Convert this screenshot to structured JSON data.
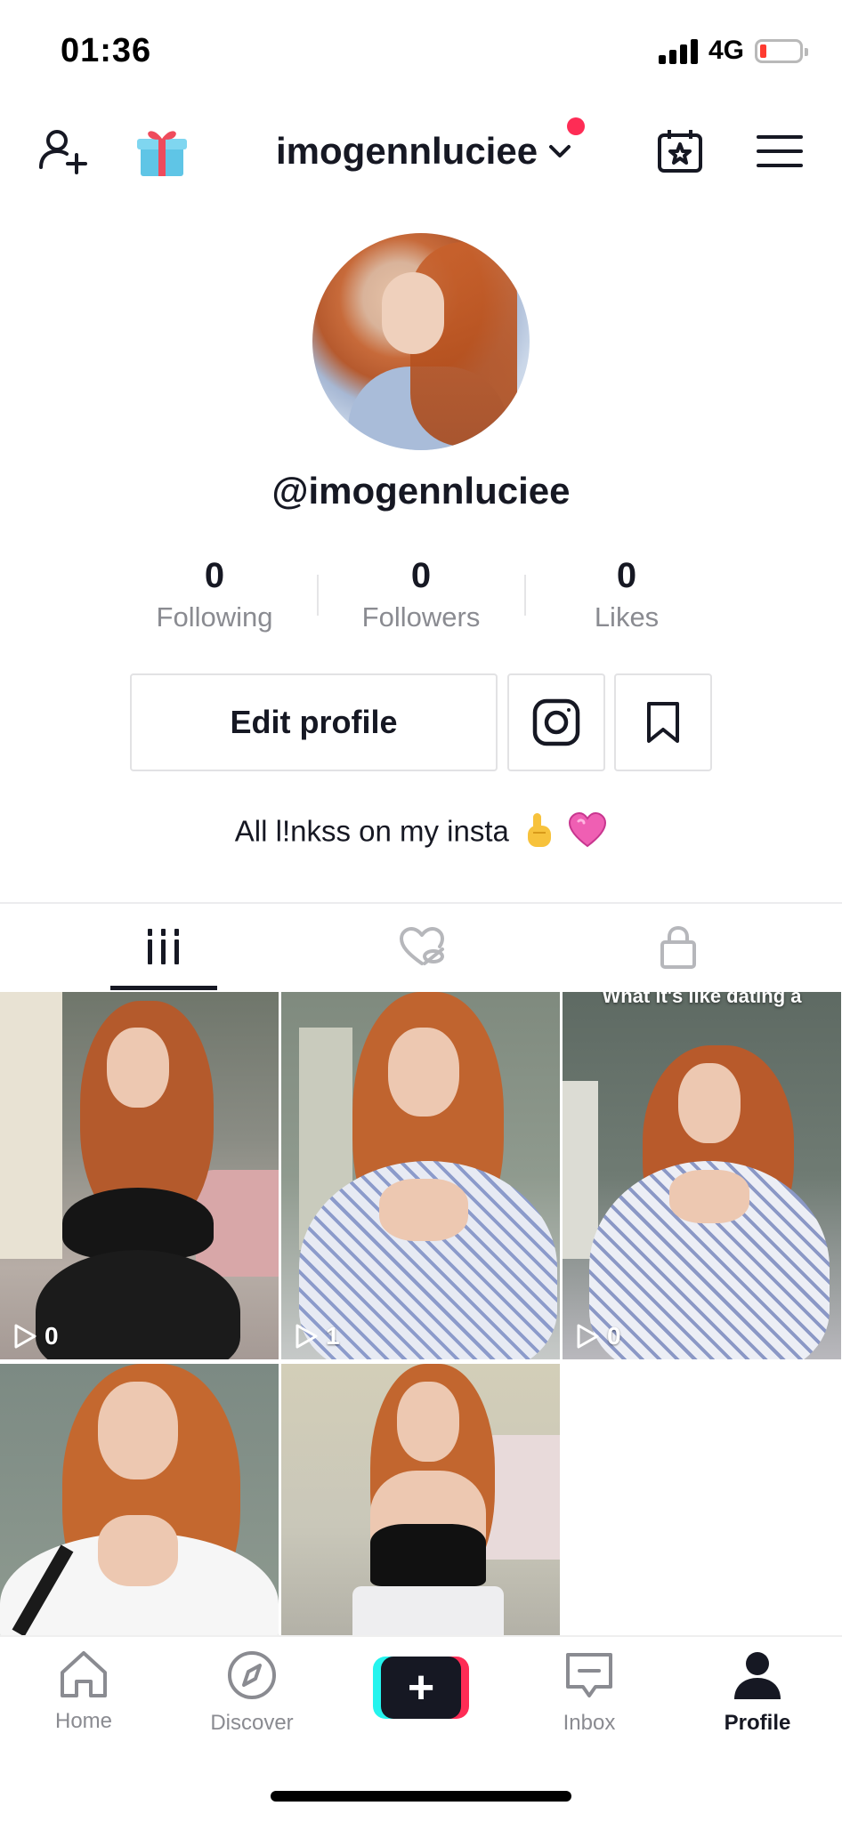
{
  "status_bar": {
    "time": "01:36",
    "network": "4G",
    "battery_level": 0.1
  },
  "header": {
    "username": "imogennluciee",
    "has_notification": true
  },
  "profile": {
    "handle": "@imogennluciee",
    "stats": [
      {
        "value": "0",
        "label": "Following"
      },
      {
        "value": "0",
        "label": "Followers"
      },
      {
        "value": "0",
        "label": "Likes"
      }
    ],
    "edit_button": "Edit profile",
    "bio": "All l!nkss on my insta",
    "bio_emoji": [
      "pointing-up-emoji",
      "heart-emoji"
    ]
  },
  "tabs": [
    {
      "icon": "videos-grid-icon",
      "active": true
    },
    {
      "icon": "liked-hidden-icon",
      "active": false
    },
    {
      "icon": "private-lock-icon",
      "active": false
    }
  ],
  "videos": [
    {
      "views": "0",
      "caption": ""
    },
    {
      "views": "1",
      "caption": ""
    },
    {
      "views": "0",
      "caption": "What it's like dating a"
    },
    {
      "views": "",
      "caption": ""
    },
    {
      "views": "",
      "caption": ""
    }
  ],
  "bottom_nav": [
    {
      "label": "Home",
      "icon": "home-icon",
      "active": false
    },
    {
      "label": "Discover",
      "icon": "compass-icon",
      "active": false
    },
    {
      "label": "",
      "icon": "create-plus-icon",
      "active": false
    },
    {
      "label": "Inbox",
      "icon": "inbox-icon",
      "active": false
    },
    {
      "label": "Profile",
      "icon": "person-icon",
      "active": true
    }
  ],
  "colors": {
    "accent": "#fe2c55",
    "cyan": "#25f4ee",
    "text": "#161823",
    "muted": "#8a8b91"
  }
}
